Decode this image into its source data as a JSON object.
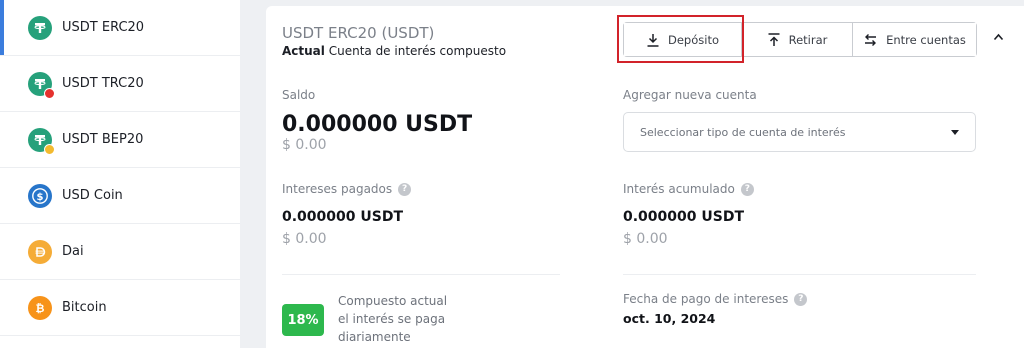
{
  "sidebar": {
    "items": [
      {
        "label": "USDT ERC20",
        "icon": "tether-icon",
        "active": true
      },
      {
        "label": "USDT TRC20",
        "icon": "tether-icon"
      },
      {
        "label": "USDT BEP20",
        "icon": "tether-icon"
      },
      {
        "label": "USD Coin",
        "icon": "usd-coin-icon"
      },
      {
        "label": "Dai",
        "icon": "dai-icon"
      },
      {
        "label": "Bitcoin",
        "icon": "bitcoin-icon"
      }
    ]
  },
  "header": {
    "title": "USDT ERC20 (USDT)",
    "subtitle_bold": "Actual",
    "subtitle_rest": "Cuenta de interés compuesto"
  },
  "actions": {
    "deposit": "Depósito",
    "withdraw": "Retirar",
    "transfer": "Entre cuentas"
  },
  "balance": {
    "label": "Saldo",
    "amount": "0.000000 USDT",
    "usd": "$ 0.00"
  },
  "new_account": {
    "label": "Agregar nueva cuenta",
    "placeholder": "Seleccionar tipo de cuenta de interés"
  },
  "interest_paid": {
    "label": "Intereses pagados",
    "amount": "0.000000 USDT",
    "usd": "$ 0.00"
  },
  "interest_accrued": {
    "label": "Interés acumulado",
    "amount": "0.000000 USDT",
    "usd": "$ 0.00"
  },
  "rate": {
    "value": "18%",
    "line1": "Compuesto actual",
    "line2": "el interés se paga",
    "line3": "diariamente"
  },
  "payment_date": {
    "label": "Fecha de pago de intereses",
    "value": "oct. 10, 2024"
  },
  "colors": {
    "tether": "#26a17b",
    "usdc": "#2775ca",
    "dai": "#f5ac37",
    "bitcoin": "#f7931a",
    "rate_badge": "#2db84d",
    "highlight": "#d2232a"
  }
}
